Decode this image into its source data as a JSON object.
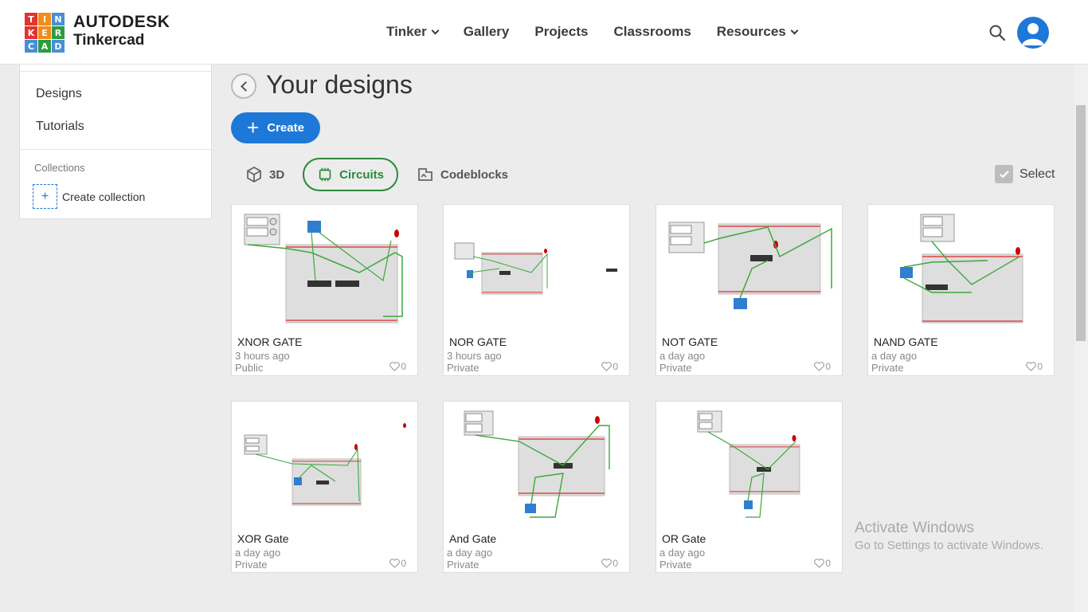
{
  "header": {
    "logo_letters": [
      "T",
      "I",
      "N",
      "K",
      "E",
      "R",
      "C",
      "A",
      "D"
    ],
    "logo_colors": [
      "#e2332c",
      "#f28c1c",
      "#4a8ed6",
      "#e2332c",
      "#f28c1c",
      "#2d9c41",
      "#4a8ed6",
      "#2d9c41",
      "#4a8ed6"
    ],
    "brand_top": "AUTODESK",
    "brand_bottom": "Tinkercad",
    "nav": [
      {
        "label": "Tinker",
        "dropdown": true
      },
      {
        "label": "Gallery",
        "dropdown": false
      },
      {
        "label": "Projects",
        "dropdown": false
      },
      {
        "label": "Classrooms",
        "dropdown": false
      },
      {
        "label": "Resources",
        "dropdown": true
      }
    ],
    "search_icon": "search-icon",
    "avatar_icon": "user-avatar-icon"
  },
  "sidebar": {
    "designs": "Designs",
    "tutorials": "Tutorials",
    "collections_label": "Collections",
    "create_collection": "Create collection"
  },
  "main": {
    "title": "Your designs",
    "create_label": "Create",
    "tabs": {
      "t3d": "3D",
      "circuits": "Circuits",
      "codeblocks": "Codeblocks"
    },
    "select_label": "Select"
  },
  "designs": [
    {
      "name": "XNOR GATE",
      "time": "3 hours ago",
      "privacy": "Public",
      "likes": "0"
    },
    {
      "name": "NOR GATE",
      "time": "3 hours ago",
      "privacy": "Private",
      "likes": "0"
    },
    {
      "name": "NOT GATE",
      "time": "a day ago",
      "privacy": "Private",
      "likes": "0"
    },
    {
      "name": "NAND GATE",
      "time": "a day ago",
      "privacy": "Private",
      "likes": "0"
    },
    {
      "name": "XOR Gate",
      "time": "a day ago",
      "privacy": "Private",
      "likes": "0"
    },
    {
      "name": "And Gate",
      "time": "a day ago",
      "privacy": "Private",
      "likes": "0"
    },
    {
      "name": "OR Gate",
      "time": "a day ago",
      "privacy": "Private",
      "likes": "0"
    }
  ],
  "watermark": {
    "line1": "Activate Windows",
    "line2": "Go to Settings to activate Windows."
  },
  "colors": {
    "accent_blue": "#1e78d8",
    "active_green": "#2a8a3a",
    "background": "#ececec"
  }
}
